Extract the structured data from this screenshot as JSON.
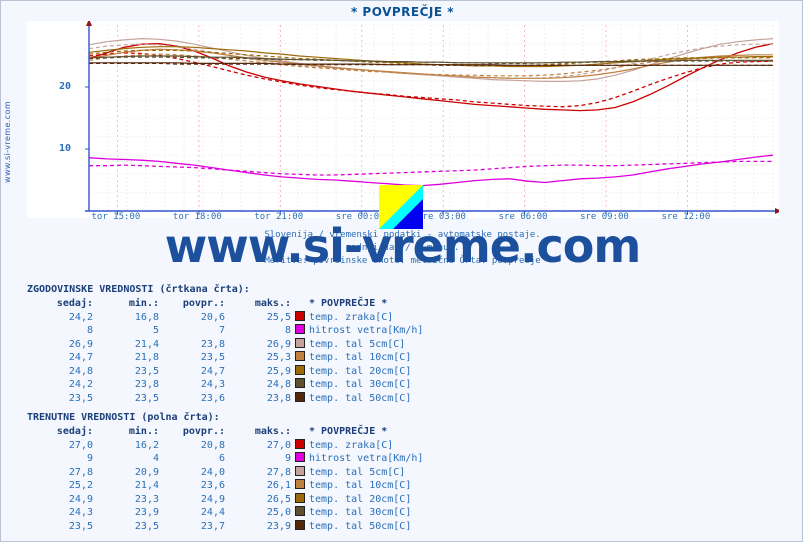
{
  "title": "* POVPREČJE *",
  "side_text": "www.si-vreme.com",
  "watermark": "www.si-vreme.com",
  "caption": {
    "line1": "Slovenija / vremenski podatki - avtomatske postaje.",
    "line2": "zadnji dan / 5 minut.",
    "line3": "Meritve: površinske enote: metrične Črta: povprečje"
  },
  "history": {
    "heading": "ZGODOVINSKE VREDNOSTI (črtkana črta):",
    "columns": [
      "sedaj:",
      "min.:",
      "povpr.:",
      "maks.:",
      "* POVPREČJE *"
    ],
    "rows": [
      {
        "sedaj": "24,2",
        "min": "16,8",
        "povpr": "20,6",
        "maks": "25,5",
        "color": "#CC0000",
        "label": "temp. zraka[C]"
      },
      {
        "sedaj": "8",
        "min": "5",
        "povpr": "7",
        "maks": "8",
        "color": "#DD00DD",
        "label": "hitrost vetra[Km/h]"
      },
      {
        "sedaj": "26,9",
        "min": "21,4",
        "povpr": "23,8",
        "maks": "26,9",
        "color": "#C4A39C",
        "label": "temp. tal  5cm[C]"
      },
      {
        "sedaj": "24,7",
        "min": "21,8",
        "povpr": "23,5",
        "maks": "25,3",
        "color": "#C08040",
        "label": "temp. tal 10cm[C]"
      },
      {
        "sedaj": "24,8",
        "min": "23,5",
        "povpr": "24,7",
        "maks": "25,9",
        "color": "#9C6A06",
        "label": "temp. tal 20cm[C]"
      },
      {
        "sedaj": "24,2",
        "min": "23,8",
        "povpr": "24,3",
        "maks": "24,8",
        "color": "#5F5030",
        "label": "temp. tal 30cm[C]"
      },
      {
        "sedaj": "23,5",
        "min": "23,5",
        "povpr": "23,6",
        "maks": "23,8",
        "color": "#55270A",
        "label": "temp. tal 50cm[C]"
      }
    ]
  },
  "current": {
    "heading": "TRENUTNE VREDNOSTI (polna črta):",
    "columns": [
      "sedaj:",
      "min.:",
      "povpr.:",
      "maks.:",
      "* POVPREČJE *"
    ],
    "rows": [
      {
        "sedaj": "27,0",
        "min": "16,2",
        "povpr": "20,8",
        "maks": "27,0",
        "color": "#CC0000",
        "label": "temp. zraka[C]"
      },
      {
        "sedaj": "9",
        "min": "4",
        "povpr": "6",
        "maks": "9",
        "color": "#DD00DD",
        "label": "hitrost vetra[Km/h]"
      },
      {
        "sedaj": "27,8",
        "min": "20,9",
        "povpr": "24,0",
        "maks": "27,8",
        "color": "#C4A39C",
        "label": "temp. tal  5cm[C]"
      },
      {
        "sedaj": "25,2",
        "min": "21,4",
        "povpr": "23,6",
        "maks": "26,1",
        "color": "#C08040",
        "label": "temp. tal 10cm[C]"
      },
      {
        "sedaj": "24,9",
        "min": "23,3",
        "povpr": "24,9",
        "maks": "26,5",
        "color": "#9C6A06",
        "label": "temp. tal 20cm[C]"
      },
      {
        "sedaj": "24,3",
        "min": "23,9",
        "povpr": "24,4",
        "maks": "25,0",
        "color": "#5F5030",
        "label": "temp. tal 30cm[C]"
      },
      {
        "sedaj": "23,5",
        "min": "23,5",
        "povpr": "23,7",
        "maks": "23,9",
        "color": "#55270A",
        "label": "temp. tal 50cm[C]"
      }
    ]
  },
  "chart_data": {
    "type": "line",
    "title": "* POVPREČJE *",
    "xlabel": "",
    "ylabel": "",
    "grid": true,
    "legend_position": "below-table",
    "ylim": [
      0,
      30
    ],
    "yticks": [
      10,
      20
    ],
    "x": [
      "tor 15:00",
      "tor 18:00",
      "tor 21:00",
      "sre 00:00",
      "sre 03:00",
      "sre 06:00",
      "sre 09:00",
      "sre 12:00"
    ],
    "xticks": [
      "tor 15:00",
      "tor 18:00",
      "tor 21:00",
      "sre 00:00",
      "sre 03:00",
      "sre 06:00",
      "sre 09:00",
      "sre 12:00"
    ],
    "series": [
      {
        "name": "temp. zraka[C] (trenutne)",
        "color": "#CC0000",
        "style": "solid",
        "values": [
          24.6,
          25.5,
          26.4,
          26.9,
          27.0,
          26.6,
          25.8,
          24.7,
          23.4,
          22.4,
          21.6,
          21.0,
          20.5,
          20.1,
          19.7,
          19.3,
          19.0,
          18.7,
          18.4,
          18.1,
          17.8,
          17.5,
          17.2,
          17.0,
          16.8,
          16.6,
          16.4,
          16.3,
          16.2,
          16.3,
          16.7,
          17.6,
          18.8,
          20.2,
          21.7,
          23.1,
          24.4,
          25.5,
          26.4,
          27.0
        ]
      },
      {
        "name": "temp. zraka[C] (zgodovinske)",
        "color": "#CC0000",
        "style": "dashed",
        "values": [
          25.0,
          25.3,
          25.5,
          25.4,
          25.1,
          24.6,
          24.0,
          23.3,
          22.6,
          21.9,
          21.3,
          20.8,
          20.3,
          19.9,
          19.6,
          19.3,
          19.0,
          18.8,
          18.5,
          18.3,
          18.1,
          17.9,
          17.6,
          17.4,
          17.2,
          17.0,
          16.9,
          16.8,
          17.0,
          17.5,
          18.3,
          19.3,
          20.4,
          21.4,
          22.3,
          23.1,
          23.7,
          24.0,
          24.1,
          24.2
        ]
      },
      {
        "name": "hitrost vetra[Km/h] (trenutne)",
        "color": "#DD00DD",
        "style": "solid",
        "values": [
          8.6,
          8.4,
          8.3,
          8.2,
          8.0,
          7.7,
          7.4,
          7.0,
          6.6,
          6.2,
          5.8,
          5.5,
          5.3,
          5.1,
          5.0,
          4.8,
          4.6,
          4.4,
          4.2,
          4.1,
          4.3,
          4.6,
          4.9,
          5.1,
          5.2,
          4.8,
          4.6,
          4.9,
          5.2,
          5.3,
          5.5,
          5.8,
          6.3,
          6.8,
          7.2,
          7.6,
          7.9,
          8.3,
          8.7,
          9.0
        ]
      },
      {
        "name": "hitrost vetra[Km/h] (zgodovinske)",
        "color": "#DD00DD",
        "style": "dashed",
        "values": [
          7.3,
          7.3,
          7.4,
          7.3,
          7.2,
          7.1,
          7.0,
          6.8,
          6.6,
          6.4,
          6.2,
          6.0,
          5.9,
          5.8,
          5.8,
          5.9,
          6.0,
          6.1,
          6.2,
          6.3,
          6.4,
          6.5,
          6.6,
          6.8,
          7.0,
          7.2,
          7.3,
          7.4,
          7.4,
          7.3,
          7.3,
          7.4,
          7.5,
          7.6,
          7.7,
          7.8,
          7.9,
          8.0,
          8.0,
          8.0
        ]
      },
      {
        "name": "temp. tal  5cm[C] (trenutne)",
        "color": "#C4A39C",
        "style": "solid",
        "values": [
          26.8,
          27.3,
          27.6,
          27.8,
          27.7,
          27.4,
          26.9,
          26.3,
          25.7,
          25.1,
          24.6,
          24.2,
          23.8,
          23.5,
          23.2,
          22.9,
          22.7,
          22.4,
          22.2,
          22.0,
          21.8,
          21.6,
          21.4,
          21.2,
          21.1,
          21.0,
          20.9,
          20.9,
          21.0,
          21.3,
          21.9,
          22.7,
          23.6,
          24.5,
          25.4,
          26.2,
          26.9,
          27.3,
          27.6,
          27.8
        ]
      },
      {
        "name": "temp. tal  5cm[C] (zgodovinske)",
        "color": "#C4A39C",
        "style": "dashed",
        "values": [
          26.2,
          26.6,
          26.8,
          26.9,
          26.8,
          26.5,
          26.1,
          25.6,
          25.1,
          24.6,
          24.2,
          23.8,
          23.5,
          23.2,
          23.0,
          22.8,
          22.6,
          22.4,
          22.2,
          22.0,
          21.9,
          21.7,
          21.6,
          21.5,
          21.4,
          21.4,
          21.5,
          21.7,
          22.0,
          22.5,
          23.1,
          23.8,
          24.5,
          25.2,
          25.8,
          26.3,
          26.6,
          26.8,
          26.9,
          26.9
        ]
      },
      {
        "name": "temp. tal 10cm[C] (trenutne)",
        "color": "#C08040",
        "style": "solid",
        "values": [
          24.6,
          25.1,
          25.6,
          25.9,
          26.1,
          26.0,
          25.8,
          25.5,
          25.1,
          24.7,
          24.3,
          24.0,
          23.7,
          23.4,
          23.1,
          22.9,
          22.7,
          22.5,
          22.3,
          22.1,
          21.9,
          21.8,
          21.6,
          21.5,
          21.4,
          21.4,
          21.4,
          21.5,
          21.7,
          22.0,
          22.4,
          22.9,
          23.5,
          24.0,
          24.5,
          24.8,
          25.0,
          25.1,
          25.2,
          25.2
        ]
      },
      {
        "name": "temp. tal 10cm[C] (zgodovinske)",
        "color": "#C08040",
        "style": "dashed",
        "values": [
          24.3,
          24.7,
          25.0,
          25.2,
          25.3,
          25.2,
          25.0,
          24.8,
          24.5,
          24.2,
          23.9,
          23.6,
          23.3,
          23.1,
          22.9,
          22.7,
          22.5,
          22.4,
          22.2,
          22.1,
          22.0,
          21.9,
          21.9,
          21.8,
          21.8,
          21.8,
          21.9,
          22.1,
          22.4,
          22.7,
          23.1,
          23.6,
          24.0,
          24.3,
          24.5,
          24.6,
          24.7,
          24.7,
          24.7,
          24.7
        ]
      },
      {
        "name": "temp. tal 20cm[C] (trenutne)",
        "color": "#9C6A06",
        "style": "solid",
        "values": [
          25.6,
          25.9,
          26.2,
          26.4,
          26.5,
          26.5,
          26.4,
          26.2,
          26.0,
          25.8,
          25.5,
          25.3,
          25.0,
          24.8,
          24.6,
          24.4,
          24.2,
          24.0,
          23.9,
          23.7,
          23.6,
          23.5,
          23.4,
          23.4,
          23.3,
          23.3,
          23.3,
          23.4,
          23.5,
          23.7,
          23.9,
          24.1,
          24.3,
          24.5,
          24.6,
          24.7,
          24.8,
          24.8,
          24.9,
          24.9
        ]
      },
      {
        "name": "temp. tal 20cm[C] (zgodovinske)",
        "color": "#9C6A06",
        "style": "dashed",
        "values": [
          25.3,
          25.6,
          25.8,
          25.9,
          25.9,
          25.9,
          25.8,
          25.6,
          25.4,
          25.2,
          25.0,
          24.8,
          24.6,
          24.5,
          24.3,
          24.2,
          24.0,
          23.9,
          23.8,
          23.7,
          23.6,
          23.6,
          23.5,
          23.5,
          23.5,
          23.5,
          23.6,
          23.7,
          23.9,
          24.1,
          24.2,
          24.4,
          24.5,
          24.6,
          24.7,
          24.7,
          24.8,
          24.8,
          24.8,
          24.8
        ]
      },
      {
        "name": "temp. tal 30cm[C] (trenutne)",
        "color": "#5F5030",
        "style": "solid",
        "values": [
          24.7,
          24.8,
          24.9,
          25.0,
          25.0,
          25.0,
          24.9,
          24.8,
          24.8,
          24.7,
          24.6,
          24.5,
          24.4,
          24.4,
          24.3,
          24.2,
          24.2,
          24.1,
          24.1,
          24.0,
          24.0,
          23.9,
          23.9,
          23.9,
          23.9,
          23.9,
          23.9,
          24.0,
          24.0,
          24.1,
          24.1,
          24.2,
          24.2,
          24.2,
          24.3,
          24.3,
          24.3,
          24.3,
          24.3,
          24.3
        ]
      },
      {
        "name": "temp. tal 30cm[C] (zgodovinske)",
        "color": "#5F5030",
        "style": "dashed",
        "values": [
          24.6,
          24.7,
          24.8,
          24.8,
          24.8,
          24.8,
          24.7,
          24.7,
          24.6,
          24.6,
          24.5,
          24.4,
          24.4,
          24.3,
          24.3,
          24.2,
          24.2,
          24.1,
          24.1,
          24.0,
          24.0,
          23.9,
          23.9,
          23.8,
          23.8,
          23.8,
          23.9,
          23.9,
          24.0,
          24.0,
          24.1,
          24.1,
          24.2,
          24.2,
          24.2,
          24.2,
          24.2,
          24.2,
          24.2,
          24.2
        ]
      },
      {
        "name": "temp. tal 50cm[C] (trenutne)",
        "color": "#55270A",
        "style": "solid",
        "values": [
          23.9,
          23.9,
          23.9,
          23.9,
          23.9,
          23.9,
          23.8,
          23.8,
          23.8,
          23.8,
          23.8,
          23.7,
          23.7,
          23.7,
          23.7,
          23.7,
          23.7,
          23.6,
          23.6,
          23.6,
          23.6,
          23.6,
          23.6,
          23.6,
          23.5,
          23.5,
          23.5,
          23.5,
          23.5,
          23.5,
          23.5,
          23.5,
          23.5,
          23.5,
          23.5,
          23.5,
          23.5,
          23.5,
          23.5,
          23.5
        ]
      },
      {
        "name": "temp. tal 50cm[C] (zgodovinske)",
        "color": "#55270A",
        "style": "dashed",
        "values": [
          23.8,
          23.8,
          23.8,
          23.8,
          23.8,
          23.7,
          23.7,
          23.7,
          23.7,
          23.7,
          23.7,
          23.7,
          23.6,
          23.6,
          23.6,
          23.6,
          23.6,
          23.6,
          23.6,
          23.6,
          23.5,
          23.5,
          23.5,
          23.5,
          23.5,
          23.5,
          23.5,
          23.5,
          23.5,
          23.5,
          23.5,
          23.5,
          23.5,
          23.5,
          23.5,
          23.5,
          23.5,
          23.5,
          23.5,
          23.5
        ]
      }
    ]
  }
}
